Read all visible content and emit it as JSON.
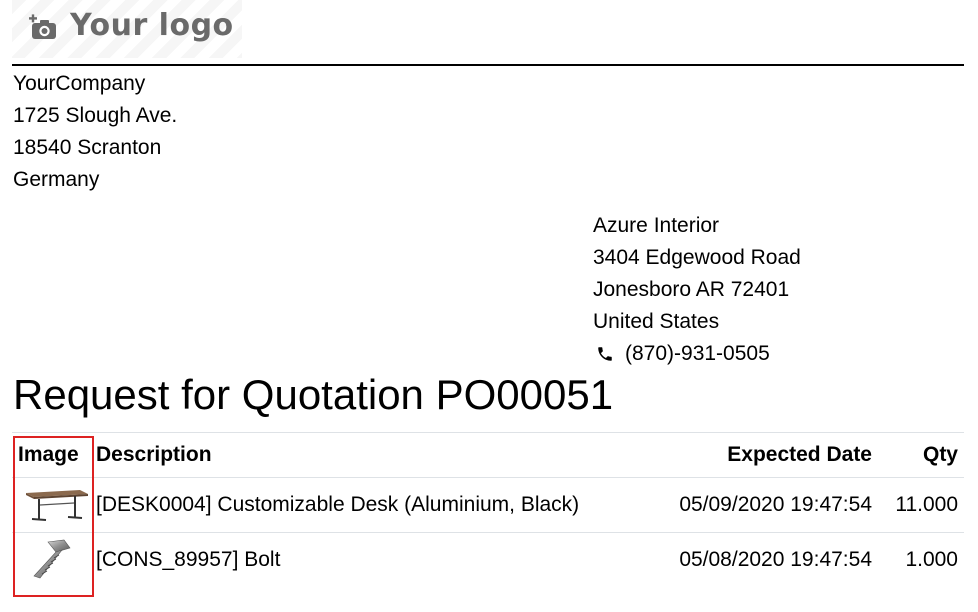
{
  "header": {
    "logo_text": "Your logo",
    "logo_icon": "camera-plus-icon"
  },
  "company": {
    "name": "YourCompany",
    "street": "1725 Slough Ave.",
    "city": "18540 Scranton",
    "country": "Germany"
  },
  "vendor": {
    "name": "Azure Interior",
    "street": "3404 Edgewood Road",
    "city": "Jonesboro AR 72401",
    "country": "United States",
    "phone_icon": "phone-icon",
    "phone": "(870)-931-0505"
  },
  "document": {
    "title": "Request for Quotation PO00051"
  },
  "table": {
    "columns": {
      "image": "Image",
      "description": "Description",
      "expected_date": "Expected Date",
      "qty": "Qty"
    },
    "rows": [
      {
        "image_icon": "desk-image",
        "description": "[DESK0004] Customizable Desk (Aluminium, Black)",
        "expected_date": "05/09/2020 19:47:54",
        "qty": "11.000"
      },
      {
        "image_icon": "bolt-image",
        "description": "[CONS_89957] Bolt",
        "expected_date": "05/08/2020 19:47:54",
        "qty": "1.000"
      }
    ]
  },
  "colors": {
    "highlight": "#dd2222",
    "logo_text": "#6a6a6a"
  }
}
